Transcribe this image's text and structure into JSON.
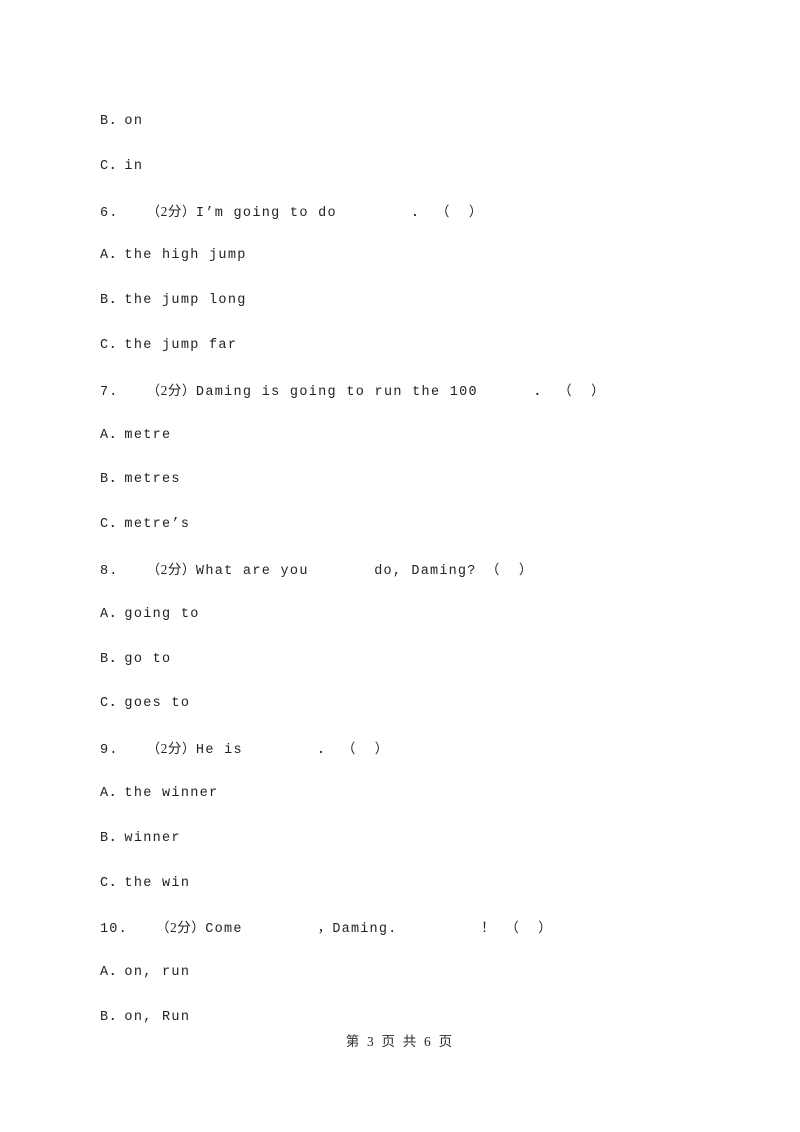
{
  "document": {
    "page_label": "第 3 页 共 6 页",
    "page_current": "3",
    "page_total": "6"
  },
  "lines": [
    {
      "kind": "option",
      "label": "B",
      "sep": "．",
      "text": "on"
    },
    {
      "kind": "option",
      "label": "C",
      "sep": "．",
      "text": "in"
    },
    {
      "kind": "question",
      "num": "6.",
      "marks": "（2分）",
      "text": "I’m going to do",
      "blank": "        ",
      "punct": "．",
      "paren": "（    ）"
    },
    {
      "kind": "option",
      "label": "A",
      "sep": "．",
      "text": "the high jump"
    },
    {
      "kind": "option",
      "label": "B",
      "sep": "．",
      "text": "the jump long"
    },
    {
      "kind": "option",
      "label": "C",
      "sep": "．",
      "text": "the jump far"
    },
    {
      "kind": "question",
      "num": "7.",
      "marks": "（2分）",
      "text": "Daming is going to run the 100",
      "blank": "      ",
      "punct": "．",
      "paren": "（    ）"
    },
    {
      "kind": "option",
      "label": "A",
      "sep": "．",
      "text": "metre"
    },
    {
      "kind": "option",
      "label": "B",
      "sep": "．",
      "text": "metres"
    },
    {
      "kind": "option",
      "label": "C",
      "sep": "．",
      "text": "metre’s"
    },
    {
      "kind": "question",
      "num": "8.",
      "marks": "（2分）",
      "text": "What are you",
      "blank": "       ",
      "punct": "do, Daming?",
      "paren": "（    ）"
    },
    {
      "kind": "option",
      "label": "A",
      "sep": "．",
      "text": "going to"
    },
    {
      "kind": "option",
      "label": "B",
      "sep": "．",
      "text": "go to"
    },
    {
      "kind": "option",
      "label": "C",
      "sep": "．",
      "text": "goes to"
    },
    {
      "kind": "question",
      "num": "9.",
      "marks": "（2分）",
      "text": "He is",
      "blank": "        ",
      "punct": "．",
      "paren": "（    ）"
    },
    {
      "kind": "option",
      "label": "A",
      "sep": "．",
      "text": "the winner"
    },
    {
      "kind": "option",
      "label": "B",
      "sep": "．",
      "text": "winner"
    },
    {
      "kind": "option",
      "label": "C",
      "sep": "．",
      "text": "the win"
    },
    {
      "kind": "question",
      "num": "10.",
      "marks": "（2分）",
      "text": "Come",
      "blank": "        ",
      "punct": "，Daming.         ！",
      "paren": "（    ）"
    },
    {
      "kind": "option",
      "label": "A",
      "sep": "．",
      "text": "on, run"
    },
    {
      "kind": "option",
      "label": "B",
      "sep": "．",
      "text": "on, Run"
    }
  ]
}
